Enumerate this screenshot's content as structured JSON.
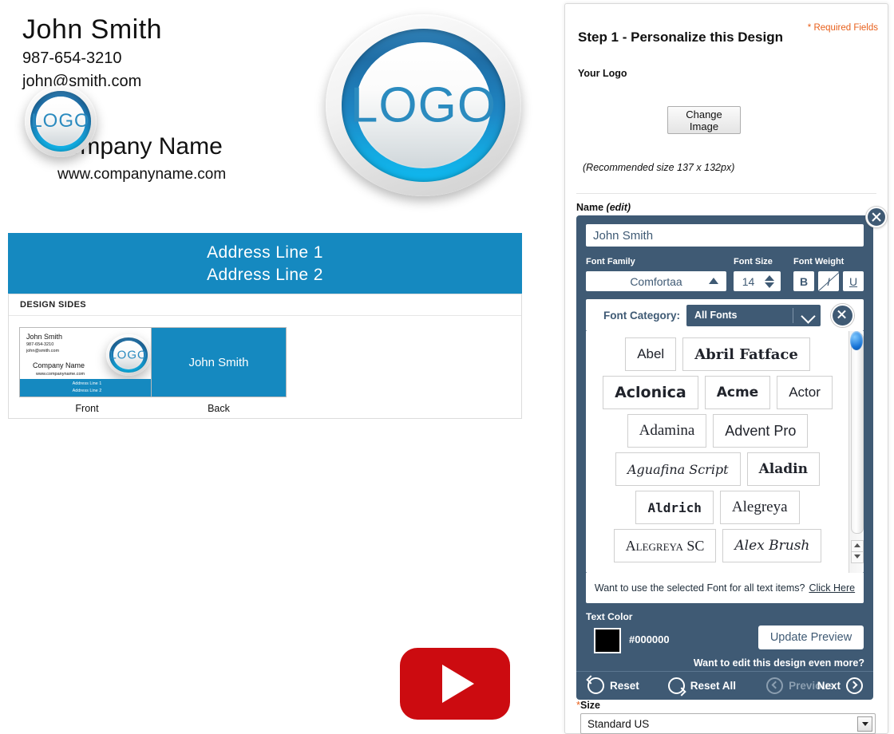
{
  "preview": {
    "name": "John Smith",
    "phone": "987-654-3210",
    "email": "john@smith.com",
    "company": "Company Name",
    "website": "www.companyname.com",
    "logo_text": "LOGO",
    "address_line_1": "Address Line 1",
    "address_line_2": "Address Line 2",
    "design_sides_header": "DESIGN SIDES",
    "thumbs": [
      {
        "label": "Front"
      },
      {
        "label": "Back"
      }
    ],
    "video_icon": "youtube-play-icon",
    "banner_color": "#1589c0"
  },
  "panel": {
    "title": "Step 1 - Personalize this Design",
    "required_note": "* Required Fields",
    "logo_label": "Your Logo",
    "change_image_label": "Change Image",
    "recommended_size": "(Recommended size 137 x 132px)",
    "name_label": "Name",
    "name_label_edit": "(edit)",
    "accent_color": "#3f5a74",
    "required_color": "#e8601c"
  },
  "editor": {
    "text_value": "John Smith",
    "font_family_label": "Font Family",
    "font_family_value": "Comfortaa",
    "font_size_label": "Font Size",
    "font_size_value": "14",
    "font_weight_label": "Font Weight",
    "bold_label": "B",
    "italic_label": "I",
    "underline_label": "U",
    "category_label": "Font Category:",
    "category_value": "All Fonts",
    "fonts": [
      {
        "name": "Abel",
        "cls": "f-abel"
      },
      {
        "name": "Abril Fatface",
        "cls": "f-abril"
      },
      {
        "name": "Aclonica",
        "cls": "f-aclonica"
      },
      {
        "name": "Acme",
        "cls": "f-acme"
      },
      {
        "name": "Actor",
        "cls": "f-actor"
      },
      {
        "name": "Adamina",
        "cls": "f-adamina"
      },
      {
        "name": "Advent Pro",
        "cls": "f-advent"
      },
      {
        "name": "Aguafina Script",
        "cls": "f-aguafina"
      },
      {
        "name": "Aladin",
        "cls": "f-aladin"
      },
      {
        "name": "Aldrich",
        "cls": "f-aldrich"
      },
      {
        "name": "Alegreya",
        "cls": "f-alegreya"
      },
      {
        "name": "Alegreya SC",
        "cls": "f-alegreyasc"
      },
      {
        "name": "Alex Brush",
        "cls": "f-alexbrush"
      }
    ],
    "use_font_all_text": "Want to use the selected Font for all text items?",
    "use_font_all_link": "Click Here",
    "text_color_label": "Text Color",
    "text_color_value": "#000000",
    "update_preview_label": "Update Preview",
    "edit_more_label": "Want to edit this design even more?",
    "reset_label": "Reset",
    "reset_all_label": "Reset All",
    "previous_label": "Previous",
    "next_label": "Next"
  },
  "size_field": {
    "label": "Size",
    "required_mark": "*",
    "value": "Standard US"
  }
}
